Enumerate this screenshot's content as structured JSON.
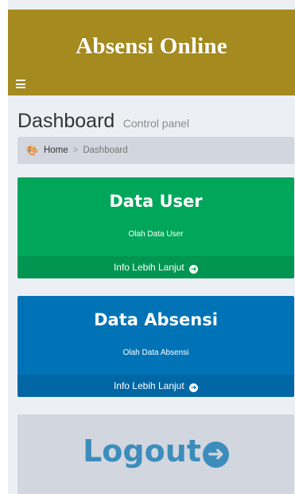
{
  "header": {
    "app_title": "Absensi Online"
  },
  "content_header": {
    "title": "Dashboard",
    "subtitle": "Control panel"
  },
  "breadcrumb": {
    "home": "Home",
    "current": "Dashboard"
  },
  "boxes": [
    {
      "title": "Data User",
      "description": "Olah Data User",
      "footer": "Info Lebih Lanjut",
      "color": "#00a65a"
    },
    {
      "title": "Data Absensi",
      "description": "Olah Data Absensi",
      "footer": "Info Lebih Lanjut",
      "color": "#0073b7"
    }
  ],
  "logout": {
    "label": "Logout",
    "color": "#3c8dbc"
  },
  "icons": {
    "menu": "hamburger-icon",
    "dashboard": "dashboard-icon",
    "arrow": "arrow-circle-right-icon"
  },
  "colors": {
    "header": "#a48a1f",
    "background": "#ecf0f5"
  }
}
